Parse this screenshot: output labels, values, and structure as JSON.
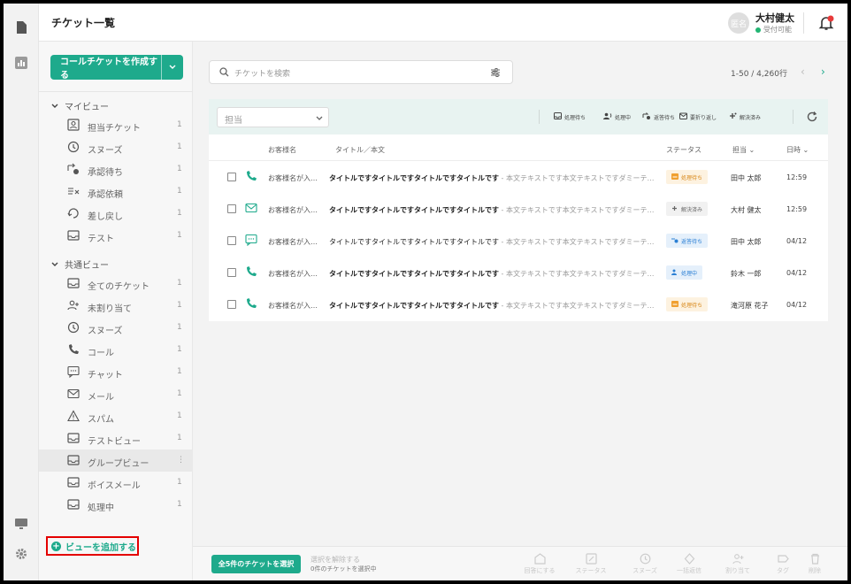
{
  "header": {
    "title": "チケット一覧",
    "avatar_text": "匿名",
    "user_name": "大村健太",
    "user_status": "受付可能"
  },
  "sidebar": {
    "create_button": "コールチケットを作成する",
    "sections": [
      {
        "title": "マイビュー",
        "items": [
          {
            "label": "担当チケット",
            "count": "1",
            "icon": "assigned-icon"
          },
          {
            "label": "スヌーズ",
            "count": "1",
            "icon": "clock-icon"
          },
          {
            "label": "承認待ち",
            "count": "1",
            "icon": "approval-wait-icon"
          },
          {
            "label": "承認依頼",
            "count": "1",
            "icon": "approval-request-icon"
          },
          {
            "label": "差し戻し",
            "count": "1",
            "icon": "return-icon"
          },
          {
            "label": "テスト",
            "count": "1",
            "icon": "inbox-icon"
          }
        ]
      },
      {
        "title": "共通ビュー",
        "items": [
          {
            "label": "全てのチケット",
            "count": "1",
            "icon": "inbox-icon"
          },
          {
            "label": "未割り当て",
            "count": "1",
            "icon": "user-add-icon"
          },
          {
            "label": "スヌーズ",
            "count": "1",
            "icon": "clock-icon"
          },
          {
            "label": "コール",
            "count": "1",
            "icon": "phone-icon"
          },
          {
            "label": "チャット",
            "count": "1",
            "icon": "chat-icon"
          },
          {
            "label": "メール",
            "count": "1",
            "icon": "mail-icon"
          },
          {
            "label": "スパム",
            "count": "1",
            "icon": "warning-icon"
          },
          {
            "label": "テストビュー",
            "count": "1",
            "icon": "inbox-icon"
          },
          {
            "label": "グループビュー",
            "count": "⋮",
            "icon": "inbox-icon"
          },
          {
            "label": "ボイスメール",
            "count": "1",
            "icon": "inbox-icon"
          },
          {
            "label": "処理中",
            "count": "1",
            "icon": "inbox-icon"
          }
        ]
      }
    ],
    "add_view": "ビューを追加する"
  },
  "search": {
    "placeholder": "チケットを検索"
  },
  "pagination": {
    "range": "1-50 / 4,260行"
  },
  "toolbar": {
    "filter_value": "担当",
    "statuses": [
      "処理待ち",
      "処理中",
      "返答待ち",
      "要折り返し",
      "解決済み"
    ]
  },
  "table": {
    "headers": {
      "customer": "お客様名",
      "title": "タイトル／本文",
      "status": "ステータス",
      "assignee": "担当",
      "datetime": "日時"
    },
    "rows": [
      {
        "channel": "phone",
        "customer": "お客様名が入…",
        "title": "タイトルですタイトルですタイトルですタイトルです",
        "body": " - 本文テキストです本文テキストですダミーテ…",
        "status": "処理待ち",
        "status_kind": "waiting",
        "assignee": "田中 太郎",
        "time": "12:59",
        "bold": true
      },
      {
        "channel": "mail",
        "customer": "お客様名が入…",
        "title": "タイトルですタイトルですタイトルですタイトルです",
        "body": " - 本文テキストです本文テキストですダミーテ…",
        "status": "解決済み",
        "status_kind": "resolved",
        "assignee": "大村 健太",
        "time": "12:59",
        "bold": true
      },
      {
        "channel": "chat",
        "customer": "お客様名が入…",
        "title": "タイトルですタイトルですタイトルですタイトルです",
        "body": " - 本文テキストです本文テキストですダミーテ…",
        "status": "返答待ち",
        "status_kind": "reply",
        "assignee": "田中 太郎",
        "time": "04/12",
        "bold": false
      },
      {
        "channel": "phone",
        "customer": "お客様名が入…",
        "title": "タイトルですタイトルですタイトルですタイトルです",
        "body": " - 本文テキストです本文テキストですダミーテ…",
        "status": "処理中",
        "status_kind": "processing",
        "assignee": "鈴木 一郎",
        "time": "04/12",
        "bold": true
      },
      {
        "channel": "phone",
        "customer": "お客様名が入…",
        "title": "タイトルですタイトルですタイトルですタイトルです",
        "body": " - 本文テキストです本文テキストですダミーテ…",
        "status": "処理待ち",
        "status_kind": "waiting",
        "assignee": "滝河原 花子",
        "time": "04/12",
        "bold": true
      }
    ]
  },
  "footer": {
    "select_all": "全5件のチケットを選択",
    "clear_selection": "選択を解除する",
    "selected_count": "0件のチケットを選択中",
    "actions": [
      "回答にする",
      "ステータス",
      "スヌーズ",
      "一括返信",
      "割り当て",
      "タグ",
      "削除"
    ]
  },
  "colors": {
    "accent": "#1eaa8c",
    "highlight_border": "#e40000",
    "waiting": "#f0a030",
    "reply": "#2a7fd4",
    "processing": "#2a7fd4"
  }
}
